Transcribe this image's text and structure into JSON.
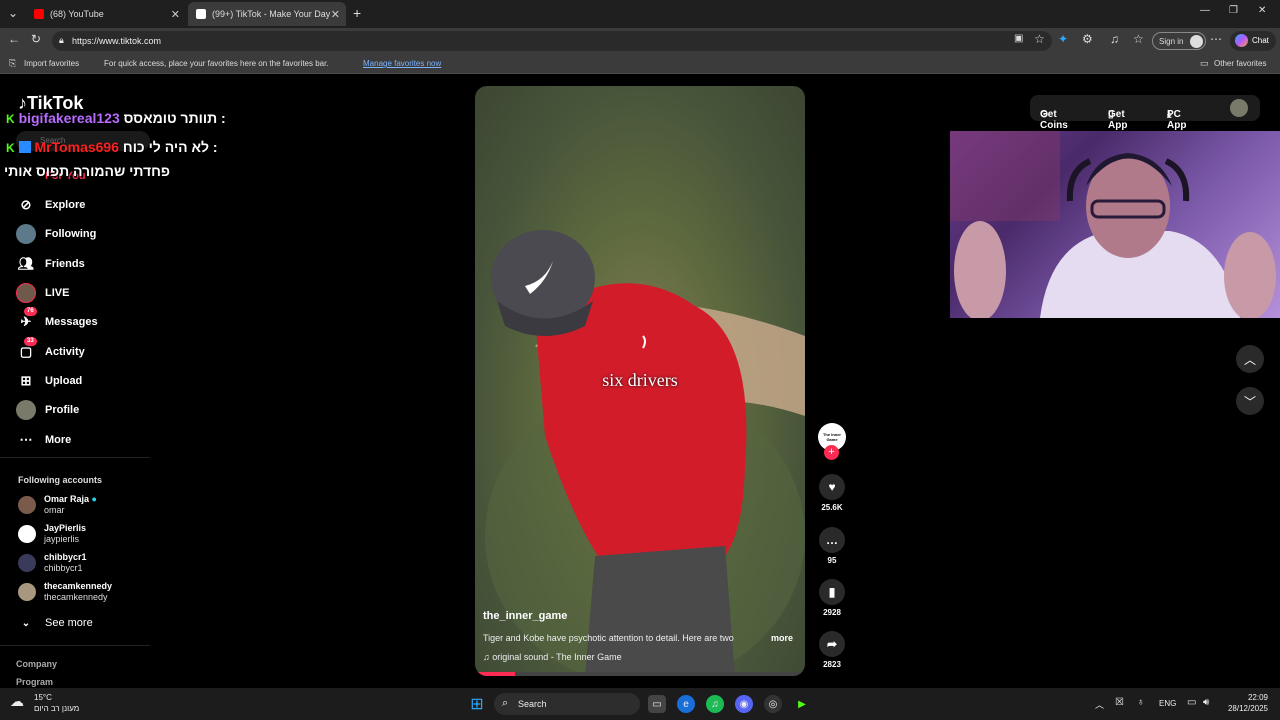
{
  "browser": {
    "tabs": [
      {
        "title": "(68) YouTube",
        "favicon_color": "#ff0000"
      },
      {
        "title": "(99+) TikTok - Make Your Day",
        "favicon_color": "#ffffff"
      }
    ],
    "url": "https://www.tiktok.com",
    "sign_in": "Sign in",
    "chat_label": "Chat",
    "favbar": {
      "import": "Import favorites",
      "message": "For quick access, place your favorites here on the favorites bar.",
      "manage": "Manage favorites now",
      "other": "Other favorites"
    }
  },
  "tiktok": {
    "logo": "TikTok",
    "search_placeholder": "Search",
    "for_you": "For You",
    "nav": [
      {
        "label": "Explore",
        "icon": "compass-icon"
      },
      {
        "label": "Following",
        "icon": "following-avatar-icon"
      },
      {
        "label": "Friends",
        "icon": "friends-icon"
      },
      {
        "label": "LIVE",
        "icon": "live-avatar-icon"
      },
      {
        "label": "Messages",
        "icon": "messages-icon",
        "badge": "76"
      },
      {
        "label": "Activity",
        "icon": "activity-icon",
        "badge": "33"
      },
      {
        "label": "Upload",
        "icon": "upload-icon"
      },
      {
        "label": "Profile",
        "icon": "profile-avatar-icon"
      },
      {
        "label": "More",
        "icon": "more-icon"
      }
    ],
    "following_title": "Following accounts",
    "accounts": [
      {
        "name": "Omar Raja",
        "username": "omar",
        "verified": true
      },
      {
        "name": "JayPierlis",
        "username": "jaypierlis"
      },
      {
        "name": "chibbycr1",
        "username": "chibbycr1"
      },
      {
        "name": "thecamkennedy",
        "username": "thecamkennedy"
      }
    ],
    "see_more": "See more",
    "footer": [
      "Company",
      "Program"
    ],
    "top_buttons": {
      "coins": "Get Coins",
      "app": "Get App",
      "pc": "PC App"
    },
    "video": {
      "caption_overlay": "six drivers",
      "author": "the_inner_game",
      "description": "Tiger and Kobe have psychotic attention to detail. Here are two",
      "more": "more",
      "sound": "original sound - The Inner Game",
      "avatar_text": "The Inner Game",
      "progress": 0.12
    },
    "actions": {
      "likes": "25.6K",
      "comments": "95",
      "saves": "2928",
      "shares": "2823"
    }
  },
  "chat_overlay": [
    {
      "user": "bigifakereal123",
      "message": "תוותר טומאסס :",
      "user_color": "#b76bff"
    },
    {
      "user": "MrTomas696",
      "message": "לא היה לי כוח :",
      "user_color": "#ff2020"
    },
    {
      "user": "",
      "message": "פחדתי שהמורה תפוס אותי",
      "user_color": "#ffffff"
    }
  ],
  "taskbar": {
    "weather_temp": "15°C",
    "weather_desc": "מעונן רב היום",
    "search": "Search",
    "lang": "ENG",
    "time": "22:09",
    "date": "28/12/2025"
  }
}
